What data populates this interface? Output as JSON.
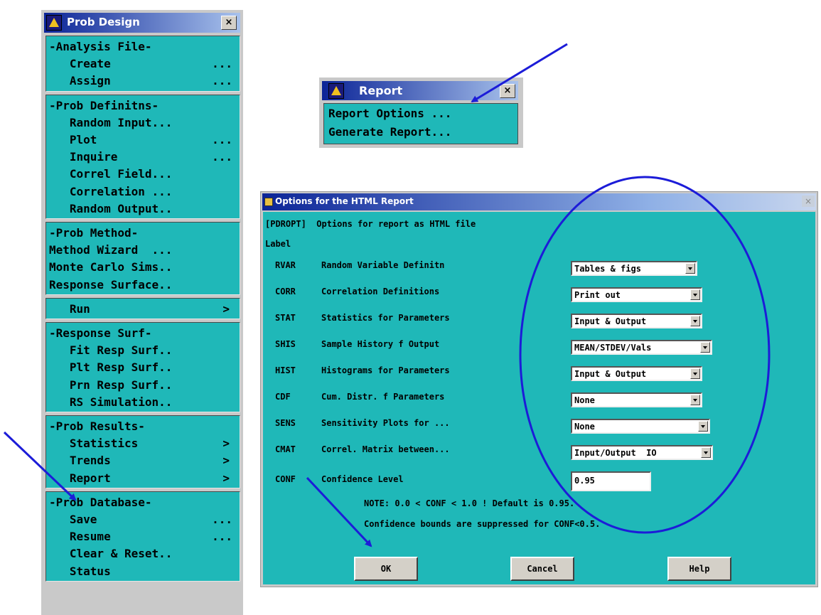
{
  "prob_design": {
    "title": "Prob Design",
    "close": "×",
    "groups": [
      {
        "items": [
          {
            "label": "-Analysis File-"
          },
          {
            "label": "   Create",
            "suffix": "..."
          },
          {
            "label": "   Assign",
            "suffix": "..."
          }
        ]
      },
      {
        "items": [
          {
            "label": "-Prob Definitns-"
          },
          {
            "label": "   Random Input..."
          },
          {
            "label": "   Plot",
            "suffix": "..."
          },
          {
            "label": "   Inquire",
            "suffix": "..."
          },
          {
            "label": "   Correl Field..."
          },
          {
            "label": "   Correlation ..."
          },
          {
            "label": "   Random Output.."
          }
        ]
      },
      {
        "items": [
          {
            "label": "-Prob Method-"
          },
          {
            "label": "Method Wizard  ..."
          },
          {
            "label": "Monte Carlo Sims.."
          },
          {
            "label": "Response Surface.."
          }
        ]
      },
      {
        "items": [
          {
            "label": "   Run",
            "arrow": ">"
          }
        ]
      },
      {
        "items": [
          {
            "label": "-Response Surf-"
          },
          {
            "label": "   Fit Resp Surf.."
          },
          {
            "label": "   Plt Resp Surf.."
          },
          {
            "label": "   Prn Resp Surf.."
          },
          {
            "label": "   RS Simulation.."
          }
        ]
      },
      {
        "items": [
          {
            "label": "-Prob Results-"
          },
          {
            "label": "   Statistics",
            "arrow": ">"
          },
          {
            "label": "   Trends",
            "arrow": ">"
          },
          {
            "label": "   Report",
            "arrow": ">"
          }
        ]
      },
      {
        "items": [
          {
            "label": "-Prob Database-"
          },
          {
            "label": "   Save",
            "suffix": "..."
          },
          {
            "label": "   Resume",
            "suffix": "..."
          },
          {
            "label": "   Clear & Reset.."
          },
          {
            "label": "   Status"
          }
        ]
      }
    ]
  },
  "report_menu": {
    "title": "Report",
    "close": "×",
    "items": [
      {
        "label": "Report Options ..."
      },
      {
        "label": "Generate Report..."
      }
    ]
  },
  "options_dialog": {
    "title": "Options for the HTML Report",
    "close": "×",
    "command": "[PDROPT]  Options for report as HTML file",
    "label_header": "Label",
    "rows": [
      {
        "code": "RVAR",
        "desc": "Random Variable Definitn",
        "value": "Tables & figs"
      },
      {
        "code": "CORR",
        "desc": "Correlation Definitions",
        "value": "Print out"
      },
      {
        "code": "STAT",
        "desc": "Statistics for Parameters",
        "value": "Input & Output"
      },
      {
        "code": "SHIS",
        "desc": "Sample History f Output",
        "value": "MEAN/STDEV/Vals"
      },
      {
        "code": "HIST",
        "desc": "Histograms for Parameters",
        "value": "Input & Output"
      },
      {
        "code": "CDF",
        "desc": "Cum. Distr. f Parameters",
        "value": "None"
      },
      {
        "code": "SENS",
        "desc": "Sensitivity Plots for ...",
        "value": "None"
      },
      {
        "code": "CMAT",
        "desc": "Correl. Matrix between...",
        "value": "Input/Output  IO"
      }
    ],
    "conf": {
      "code": "CONF",
      "desc": "Confidence Level",
      "value": "0.95"
    },
    "note1": "NOTE: 0.0 < CONF < 1.0 ! Default is 0.95.",
    "note2": "Confidence bounds are suppressed for CONF<0.5.",
    "buttons": {
      "ok": "OK",
      "cancel": "Cancel",
      "help": "Help"
    }
  },
  "annotation_color": "#1c1cd8"
}
